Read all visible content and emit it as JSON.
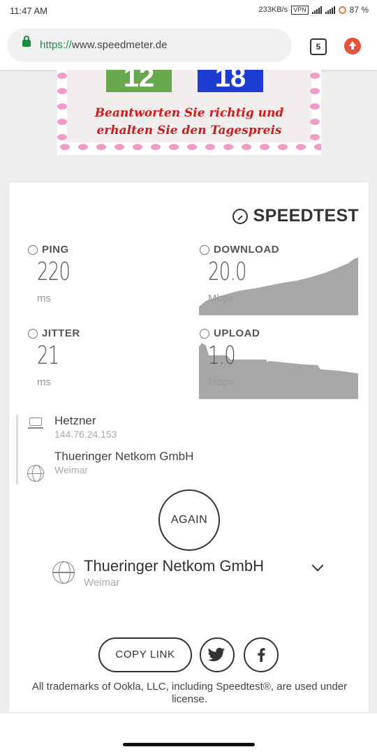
{
  "status_bar": {
    "time": "11:47 AM",
    "speed": "233KB/s",
    "vpn": "VPN",
    "battery": "87 %"
  },
  "browser": {
    "url_scheme": "https://",
    "url_host": "www.speedmeter.de",
    "tab_count": "5"
  },
  "ad": {
    "number_left": "12",
    "number_right": "18",
    "line1": "Beantworten Sie richtig und",
    "line2": "erhalten Sie den Tagespreis"
  },
  "speedtest": {
    "brand": "SPEEDTEST",
    "ping": {
      "label": "PING",
      "value": "220",
      "unit": "ms"
    },
    "download": {
      "label": "DOWNLOAD",
      "value": "20.0",
      "unit": "Mbps"
    },
    "jitter": {
      "label": "JITTER",
      "value": "21",
      "unit": "ms"
    },
    "upload": {
      "label": "UPLOAD",
      "value": "1.0",
      "unit": "Mbps"
    },
    "server": {
      "name": "Hetzner",
      "ip": "144.76.24.153"
    },
    "isp": {
      "name": "Thueringer Netkom GmbH",
      "location": "Weimar"
    },
    "again_label": "AGAIN",
    "selected_isp": {
      "name": "Thueringer Netkom GmbH",
      "location": "Weimar"
    },
    "copy_link_label": "COPY LINK",
    "trademark": "All trademarks of Ookla, LLC, including Speedtest®, are used under license."
  },
  "colors": {
    "graph_fill": "#a7a7a7",
    "accent_green": "#198f3a",
    "ad_red": "#d21a1a"
  }
}
